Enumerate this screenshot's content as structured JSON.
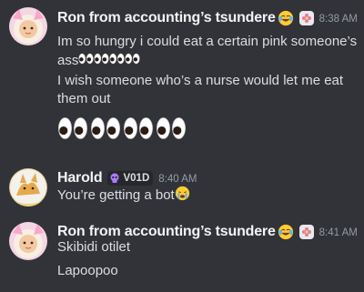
{
  "messages": [
    {
      "username": "Ron from accounting’s tsundere",
      "time": "8:38 AM",
      "lines": [
        "Im so hungry i could eat a certain pink someone’s",
        "ass",
        "I wish someone who’s a nurse would let me eat",
        "them out"
      ],
      "username_emoji": "joy-emoji",
      "role_icon": "flower-icon",
      "inline_emojis": [
        "eyes-emoji",
        "eyes-emoji",
        "eyes-emoji",
        "eyes-emoji"
      ],
      "big_emojis": [
        "eyes-emoji",
        "eyes-emoji",
        "eyes-emoji",
        "eyes-emoji"
      ]
    },
    {
      "username": "Harold",
      "tag": "V01D",
      "time": "8:40 AM",
      "lines": [
        "You’re getting a bot"
      ],
      "tag_icon": "skull-icon",
      "inline_emojis": [
        "sob-emoji"
      ]
    },
    {
      "username": "Ron from accounting’s tsundere",
      "time": "8:41 AM",
      "lines": [
        "Skibidi otilet",
        "Lapoopoo"
      ],
      "username_emoji": "joy-emoji",
      "role_icon": "flower-icon"
    }
  ],
  "colors": {
    "background": "#313338",
    "username": "#f2f3f5",
    "text": "#dbdee1",
    "timestamp": "#949ba4",
    "tag_bg": "#26272b",
    "tag_icon": "#b07aff"
  }
}
